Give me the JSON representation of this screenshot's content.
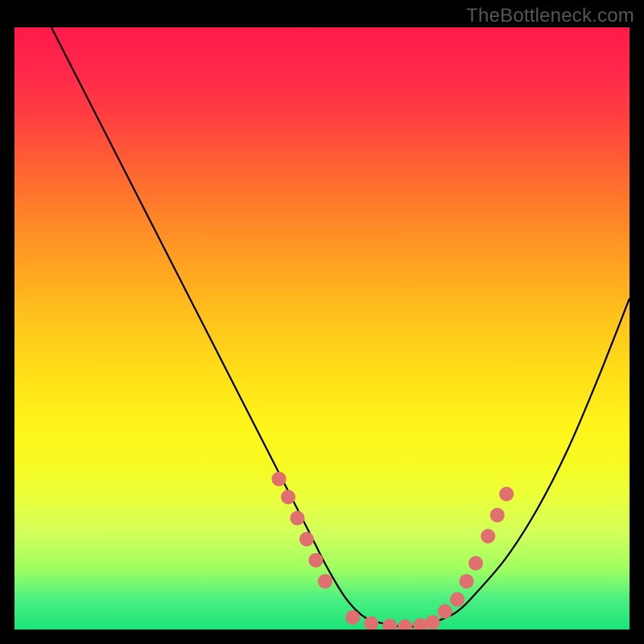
{
  "watermark": "TheBottleneck.com",
  "chart_data": {
    "type": "line",
    "title": "",
    "xlabel": "",
    "ylabel": "",
    "xlim": [
      0,
      100
    ],
    "ylim": [
      0,
      100
    ],
    "background_gradient": {
      "top": "#ff1a4a",
      "mid": "#ffe018",
      "bottom": "#1ce478"
    },
    "series": [
      {
        "name": "bottleneck-curve",
        "stroke": "#000000",
        "x": [
          6,
          12,
          18,
          24,
          30,
          36,
          42,
          48,
          51,
          54,
          57,
          60,
          63,
          66,
          69,
          72,
          75,
          80,
          85,
          90,
          95,
          100
        ],
        "y": [
          100,
          88,
          76,
          64,
          52,
          40,
          28,
          16,
          10,
          5,
          2,
          1,
          0.5,
          0.6,
          1.5,
          3,
          6,
          12,
          20,
          30,
          42,
          55
        ]
      }
    ],
    "scatter": [
      {
        "name": "highlight-dots",
        "color": "#e07070",
        "radius": 9,
        "points": [
          {
            "x": 43,
            "y": 25
          },
          {
            "x": 44.5,
            "y": 22
          },
          {
            "x": 46,
            "y": 18.5
          },
          {
            "x": 47.5,
            "y": 15
          },
          {
            "x": 49,
            "y": 11.5
          },
          {
            "x": 50.5,
            "y": 8
          },
          {
            "x": 55,
            "y": 2
          },
          {
            "x": 58,
            "y": 1
          },
          {
            "x": 61,
            "y": 0.6
          },
          {
            "x": 63.5,
            "y": 0.5
          },
          {
            "x": 66,
            "y": 0.7
          },
          {
            "x": 68,
            "y": 1.2
          },
          {
            "x": 70,
            "y": 3
          },
          {
            "x": 72,
            "y": 5
          },
          {
            "x": 73.5,
            "y": 8
          },
          {
            "x": 75,
            "y": 11
          },
          {
            "x": 77,
            "y": 15.5
          },
          {
            "x": 78.5,
            "y": 19
          },
          {
            "x": 80,
            "y": 22.5
          }
        ]
      }
    ]
  }
}
